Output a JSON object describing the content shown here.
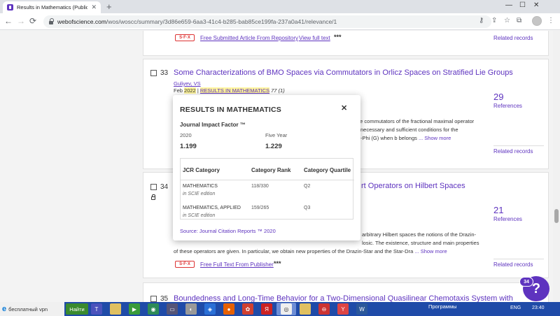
{
  "browser": {
    "tab_title": "Results in Mathematics (Publicat...",
    "tab_close": "✕",
    "new_tab": "+",
    "url_host": "webofscience.com",
    "url_path": "/wos/woscc/summary/3d86e659-6aa3-41c4-b285-bab85ce199fa-237a0a41/relevance/1",
    "back": "←",
    "forward": "→",
    "reload": "⟳",
    "minimize": "—",
    "maximize": "☐",
    "close": "✕"
  },
  "results": [
    {
      "sfx": "S·F·X",
      "link1": "Free Submitted Article From Repository",
      "link2": "View full text",
      "more": "***",
      "related": "Related records"
    },
    {
      "number": "33",
      "title": "Some Characterizations of BMO Spaces via Commutators in Orlicz Spaces on Stratified Lie Groups",
      "author": "Guliyev, VS",
      "date_prefix": "Feb",
      "year": "2022",
      "separator": "|",
      "journal": "RESULTS IN MATHEMATICS",
      "volume": "77 (1)",
      "abstract_line1": "he commutators of the fractional maximal operator",
      "abstract_line2": "necessary and sufficient conditions for the",
      "abstract_line3": "-Phi (G) when b belongs",
      "show_more": "... Show more",
      "citations": "29",
      "references": "References",
      "related": "Related records"
    },
    {
      "number": "34",
      "title_fragment": "rt Operators on Hilbert Spaces",
      "abstract_line1": "arbitrary Hilbert spaces the notions of the Drazin-",
      "abstract_line2": "losic. The existence, structure and main properties",
      "abstract_line3": "of these operators are given. In particular, we obtain new properties of the Drazin-Star and the Star-Dra",
      "show_more": "... Show more",
      "citations": "21",
      "references": "References",
      "sfx": "S·F·X",
      "link1": "Free Full Text From Publisher",
      "more": "***",
      "related": "Related records"
    },
    {
      "number": "35",
      "title": "Boundedness and Long-Time Behavior for a Two-Dimensional Quasilinear Chemotaxis System with"
    }
  ],
  "popup": {
    "title": "RESULTS IN MATHEMATICS",
    "close": "✕",
    "jif_label": "Journal Impact Factor ™",
    "year_label": "2020",
    "year_value": "1.199",
    "five_label": "Five Year",
    "five_value": "1.229",
    "headers": [
      "JCR Category",
      "Category Rank",
      "Category Quartile"
    ],
    "rows": [
      {
        "category": "MATHEMATICS",
        "edition": "in SCIE edition",
        "rank": "118/330",
        "quartile": "Q2"
      },
      {
        "category": "MATHEMATICS, APPLIED",
        "edition": "in SCIE edition",
        "rank": "159/265",
        "quartile": "Q3"
      }
    ],
    "source": "Source: Journal Citation Reports ™ 2020"
  },
  "chat": {
    "count": "34",
    "symbol": "?"
  },
  "taskbar": {
    "vpn": "бесплатный vpn",
    "start": "Найти",
    "tray": "Программы",
    "lang": "ENG",
    "clock": "23:40"
  },
  "colors": {
    "accent": "#5e33bf",
    "highlight": "#fff59d",
    "taskbar": "#1f4ba8"
  }
}
